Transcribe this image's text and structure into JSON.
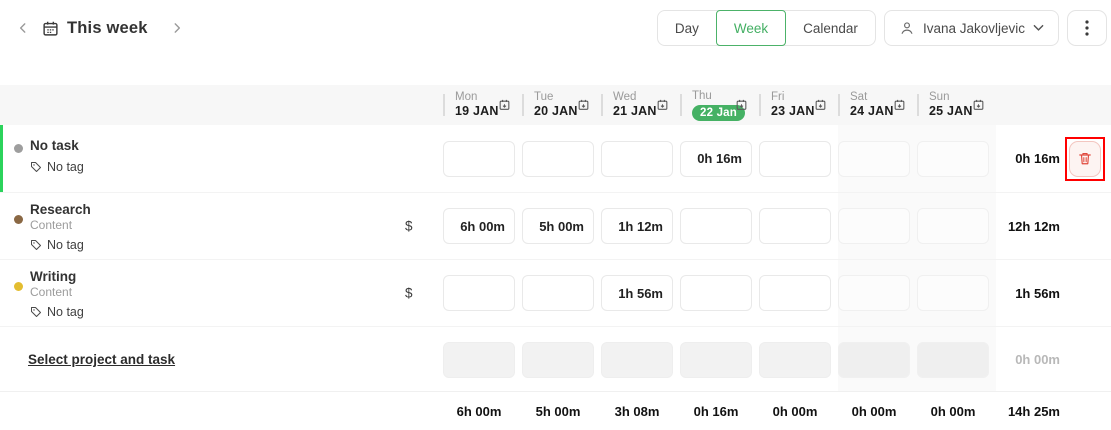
{
  "topbar": {
    "title": "This week",
    "views": [
      {
        "label": "Day"
      },
      {
        "label": "Week"
      },
      {
        "label": "Calendar"
      }
    ],
    "active_view": "Week",
    "user_name": "Ivana Jakovljevic"
  },
  "week": {
    "days": [
      {
        "abbr": "Mon",
        "date": "19 JAN"
      },
      {
        "abbr": "Tue",
        "date": "20 JAN"
      },
      {
        "abbr": "Wed",
        "date": "21 JAN"
      },
      {
        "abbr": "Thu",
        "date": "22 Jan",
        "today": true
      },
      {
        "abbr": "Fri",
        "date": "23 JAN"
      },
      {
        "abbr": "Sat",
        "date": "24 JAN"
      },
      {
        "abbr": "Sun",
        "date": "25 JAN"
      }
    ]
  },
  "rows": [
    {
      "task": "No task",
      "tag": "No tag",
      "dot_color": "#9e9e9e",
      "cells": [
        "",
        "",
        "",
        "0h 16m",
        "",
        "",
        ""
      ],
      "total": "0h 16m"
    },
    {
      "task": "Research",
      "project": "Content",
      "tag": "No tag",
      "dot_color": "#8a6844",
      "billable_symbol": "$",
      "cells": [
        "6h 00m",
        "5h 00m",
        "1h 12m",
        "",
        "",
        "",
        ""
      ],
      "total": "12h 12m"
    },
    {
      "task": "Writing",
      "project": "Content",
      "tag": "No tag",
      "dot_color": "#e3bd30",
      "billable_symbol": "$",
      "cells": [
        "",
        "",
        "1h 56m",
        "",
        "",
        "",
        ""
      ],
      "total": "1h 56m"
    },
    {
      "task": "Select project and task",
      "cells": [
        "",
        "",
        "",
        "",
        "",
        "",
        ""
      ],
      "total": "0h 00m"
    }
  ],
  "footer": {
    "day_totals": [
      "6h 00m",
      "5h 00m",
      "3h 08m",
      "0h 16m",
      "0h 00m",
      "0h 00m",
      "0h 00m"
    ],
    "week_total": "14h 25m"
  },
  "colors": {
    "accent_green": "#43af63",
    "today_pill_green": "#45b164",
    "row_highlight_green": "#2bd35b",
    "annotation_red": "#ff0000",
    "trash_red": "#e0483c"
  }
}
